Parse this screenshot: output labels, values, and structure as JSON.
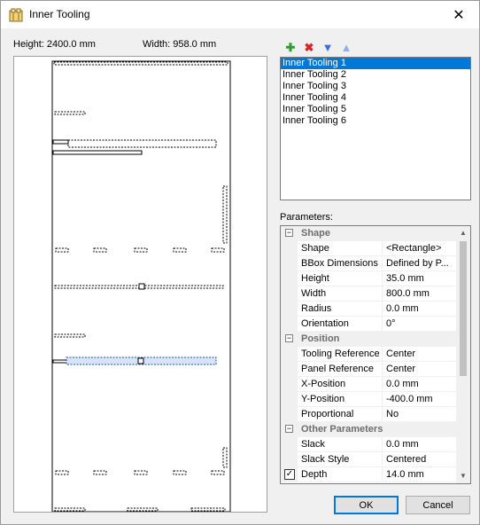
{
  "window": {
    "title": "Inner Tooling"
  },
  "dimensions": {
    "height_label": "Height: 2400.0 mm",
    "width_label": "Width: 958.0 mm"
  },
  "toolbar": {
    "add": {
      "icon": "plus-icon",
      "color": "#2e9e2e"
    },
    "delete": {
      "icon": "delete-x-icon",
      "color": "#e02020"
    },
    "move_down": {
      "icon": "arrow-down-icon",
      "color": "#3a6fd8"
    },
    "move_up": {
      "icon": "arrow-up-icon",
      "color": "#8fb0e8"
    }
  },
  "tooling_list": {
    "items": [
      "Inner Tooling 1",
      "Inner Tooling 2",
      "Inner Tooling 3",
      "Inner Tooling 4",
      "Inner Tooling 5",
      "Inner Tooling 6"
    ],
    "selected_index": 0
  },
  "parameters": {
    "label": "Parameters:",
    "categories": {
      "shape": {
        "title": "Shape",
        "rows": [
          {
            "name": "Shape",
            "value": "<Rectangle>"
          },
          {
            "name": "BBox Dimensions",
            "value": "Defined by P..."
          },
          {
            "name": "Height",
            "value": "35.0 mm"
          },
          {
            "name": "Width",
            "value": "800.0 mm"
          },
          {
            "name": "Radius",
            "value": "0.0 mm"
          },
          {
            "name": "Orientation",
            "value": "0°"
          }
        ]
      },
      "position": {
        "title": "Position",
        "rows": [
          {
            "name": "Tooling Reference",
            "value": "Center"
          },
          {
            "name": "Panel Reference",
            "value": "Center"
          },
          {
            "name": "X-Position",
            "value": "0.0 mm"
          },
          {
            "name": "Y-Position",
            "value": "-400.0 mm"
          },
          {
            "name": "Proportional",
            "value": "No"
          }
        ]
      },
      "other": {
        "title": "Other Parameters",
        "rows": [
          {
            "name": "Slack",
            "value": "0.0 mm"
          },
          {
            "name": "Slack Style",
            "value": "Centered"
          },
          {
            "name": "Depth",
            "value": "14.0 mm",
            "checked": true
          }
        ]
      }
    }
  },
  "buttons": {
    "ok": "OK",
    "cancel": "Cancel"
  },
  "colors": {
    "selection": "#0078d7",
    "preview_highlight": "#1e4fa8"
  }
}
